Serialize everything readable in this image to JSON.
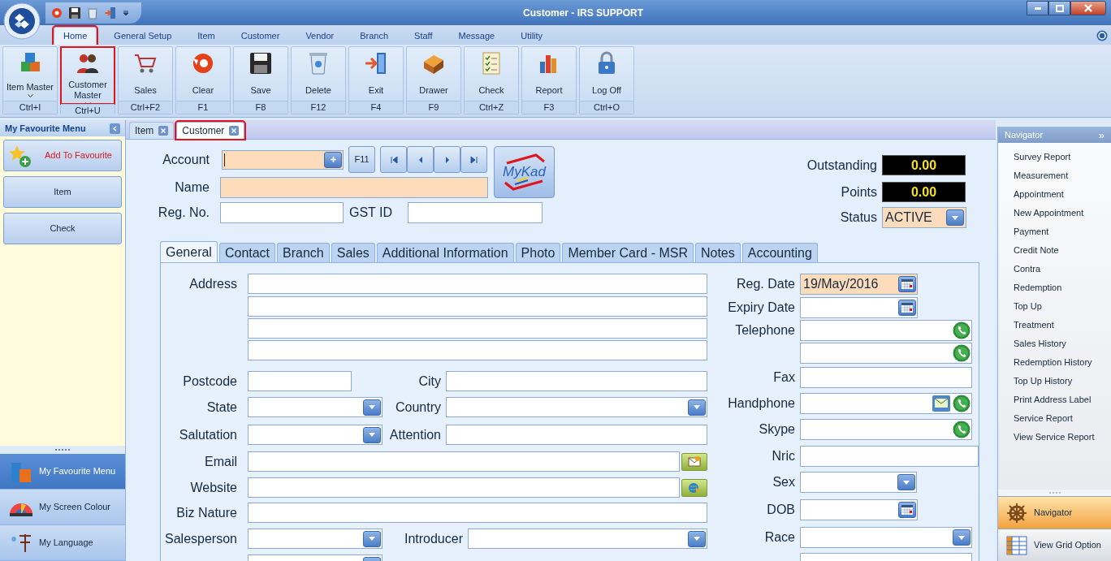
{
  "window": {
    "title": "Customer - IRS SUPPORT"
  },
  "menu_tabs": [
    {
      "label": "Home",
      "selected": true,
      "highlighted": true
    },
    {
      "label": "General Setup",
      "selected": false,
      "highlighted": false
    },
    {
      "label": "Item",
      "selected": false,
      "highlighted": false
    },
    {
      "label": "Customer",
      "selected": false,
      "highlighted": false
    },
    {
      "label": "Vendor",
      "selected": false,
      "highlighted": false
    },
    {
      "label": "Branch",
      "selected": false,
      "highlighted": false
    },
    {
      "label": "Staff",
      "selected": false,
      "highlighted": false
    },
    {
      "label": "Message",
      "selected": false,
      "highlighted": false
    },
    {
      "label": "Utility",
      "selected": false,
      "highlighted": false
    }
  ],
  "ribbon": [
    {
      "label": "Item Master",
      "dropdown": true,
      "shortcut": "Ctrl+I",
      "highlighted": false
    },
    {
      "label": "Customer Master",
      "dropdown": true,
      "shortcut": "Ctrl+U",
      "highlighted": true
    },
    {
      "label": "Sales",
      "dropdown": false,
      "shortcut": "Ctrl+F2",
      "highlighted": false
    },
    {
      "label": "Clear",
      "dropdown": false,
      "shortcut": "F1",
      "highlighted": false
    },
    {
      "label": "Save",
      "dropdown": false,
      "shortcut": "F8",
      "highlighted": false
    },
    {
      "label": "Delete",
      "dropdown": false,
      "shortcut": "F12",
      "highlighted": false
    },
    {
      "label": "Exit",
      "dropdown": false,
      "shortcut": "F4",
      "highlighted": false
    },
    {
      "label": "Drawer",
      "dropdown": false,
      "shortcut": "F9",
      "highlighted": false
    },
    {
      "label": "Check",
      "dropdown": false,
      "shortcut": "Ctrl+Z",
      "highlighted": false
    },
    {
      "label": "Report",
      "dropdown": false,
      "shortcut": "F3",
      "highlighted": false
    },
    {
      "label": "Log Off",
      "dropdown": false,
      "shortcut": "Ctrl+O",
      "highlighted": false
    }
  ],
  "sidebar": {
    "title": "My Favourite Menu",
    "favourites": [
      {
        "label": "Add To Favourite",
        "kind": "add"
      },
      {
        "label": "Item",
        "kind": "link"
      },
      {
        "label": "Check",
        "kind": "link"
      }
    ],
    "bottom_nav": [
      {
        "label": "My Favourite Menu",
        "selected": true
      },
      {
        "label": "My Screen Colour",
        "selected": false
      },
      {
        "label": "My Language",
        "selected": false
      }
    ]
  },
  "doc_tabs": [
    {
      "label": "Item",
      "selected": false,
      "highlighted": false
    },
    {
      "label": "Customer",
      "selected": true,
      "highlighted": true
    }
  ],
  "header": {
    "account": {
      "label": "Account",
      "required": true
    },
    "f11": "F11",
    "mykad": "MyKad",
    "name": {
      "label": "Name",
      "required": true
    },
    "reg_no": {
      "label": "Reg. No.",
      "required": false
    },
    "gst_id": {
      "label": "GST ID",
      "required": false
    },
    "outstanding": {
      "label": "Outstanding",
      "value": "0.00"
    },
    "points": {
      "label": "Points",
      "value": "0.00"
    },
    "status": {
      "label": "Status",
      "value": "ACTIVE"
    }
  },
  "form_tabs": [
    {
      "label": "General",
      "selected": true
    },
    {
      "label": "Contact",
      "selected": false
    },
    {
      "label": "Branch",
      "selected": false
    },
    {
      "label": "Sales",
      "selected": false
    },
    {
      "label": "Additional Information",
      "selected": false
    },
    {
      "label": "Photo",
      "selected": false
    },
    {
      "label": "Member Card - MSR",
      "selected": false
    },
    {
      "label": "Notes",
      "selected": false
    },
    {
      "label": "Accounting",
      "selected": false
    }
  ],
  "general_left": [
    [
      {
        "label": "Address",
        "kind": "text",
        "required": false
      }
    ],
    [
      {
        "kind": "text",
        "required": false
      }
    ],
    [
      {
        "kind": "text",
        "required": false
      }
    ],
    [
      {
        "kind": "text",
        "required": false
      }
    ],
    [
      {
        "label": "Postcode",
        "kind": "text",
        "required": false
      },
      {
        "label": "City",
        "kind": "text",
        "required": false
      }
    ],
    [
      {
        "label": "State",
        "kind": "dropdown",
        "required": false
      },
      {
        "label": "Country",
        "kind": "dropdown",
        "required": false
      }
    ],
    [
      {
        "label": "Salutation",
        "kind": "dropdown",
        "required": false
      },
      {
        "label": "Attention",
        "kind": "text",
        "required": false
      }
    ],
    [
      {
        "label": "Email",
        "kind": "email",
        "required": false
      }
    ],
    [
      {
        "label": "Website",
        "kind": "web",
        "required": false
      }
    ],
    [
      {
        "label": "Biz Nature",
        "kind": "text",
        "required": false
      }
    ],
    [
      {
        "label": "Salesperson",
        "kind": "dropdown",
        "required": false
      },
      {
        "label": "Introducer",
        "kind": "dropdown",
        "required": false
      }
    ],
    [
      {
        "kind": "dropdown",
        "required": false
      }
    ]
  ],
  "general_right": [
    {
      "label": "Reg. Date",
      "kind": "date",
      "value": "19/May/2016",
      "required": true
    },
    {
      "label": "Expiry Date",
      "kind": "date",
      "required": false
    },
    {
      "label": "Telephone",
      "kind": "phone",
      "required": false
    },
    {
      "kind": "phone",
      "required": false
    },
    {
      "label": "Fax",
      "kind": "text",
      "required": false
    },
    {
      "label": "Handphone",
      "kind": "phone_sms",
      "required": false
    },
    {
      "label": "Skype",
      "kind": "phone",
      "required": false
    },
    {
      "label": "Nric",
      "kind": "text",
      "required": false
    },
    {
      "label": "Sex",
      "kind": "dropdown",
      "required": false
    },
    {
      "label": "DOB",
      "kind": "date",
      "required": false
    },
    {
      "label": "Race",
      "kind": "dropdown",
      "required": false
    },
    {
      "kind": "text",
      "required": false
    }
  ],
  "navigator": {
    "title": "Navigator",
    "collapse": "»",
    "items": [
      "Survey Report",
      "Measurement",
      "Appointment",
      "New Appointment",
      "Payment",
      "Credit Note",
      "Contra",
      "Redemption",
      "Top Up",
      "Treatment",
      "Sales History",
      "Redemption History",
      "Top Up History",
      "Print Address Label",
      "Service Report",
      "View Service Report"
    ],
    "bottom": [
      {
        "label": "Navigator",
        "selected": true
      },
      {
        "label": "View Grid Option",
        "selected": false
      }
    ]
  }
}
